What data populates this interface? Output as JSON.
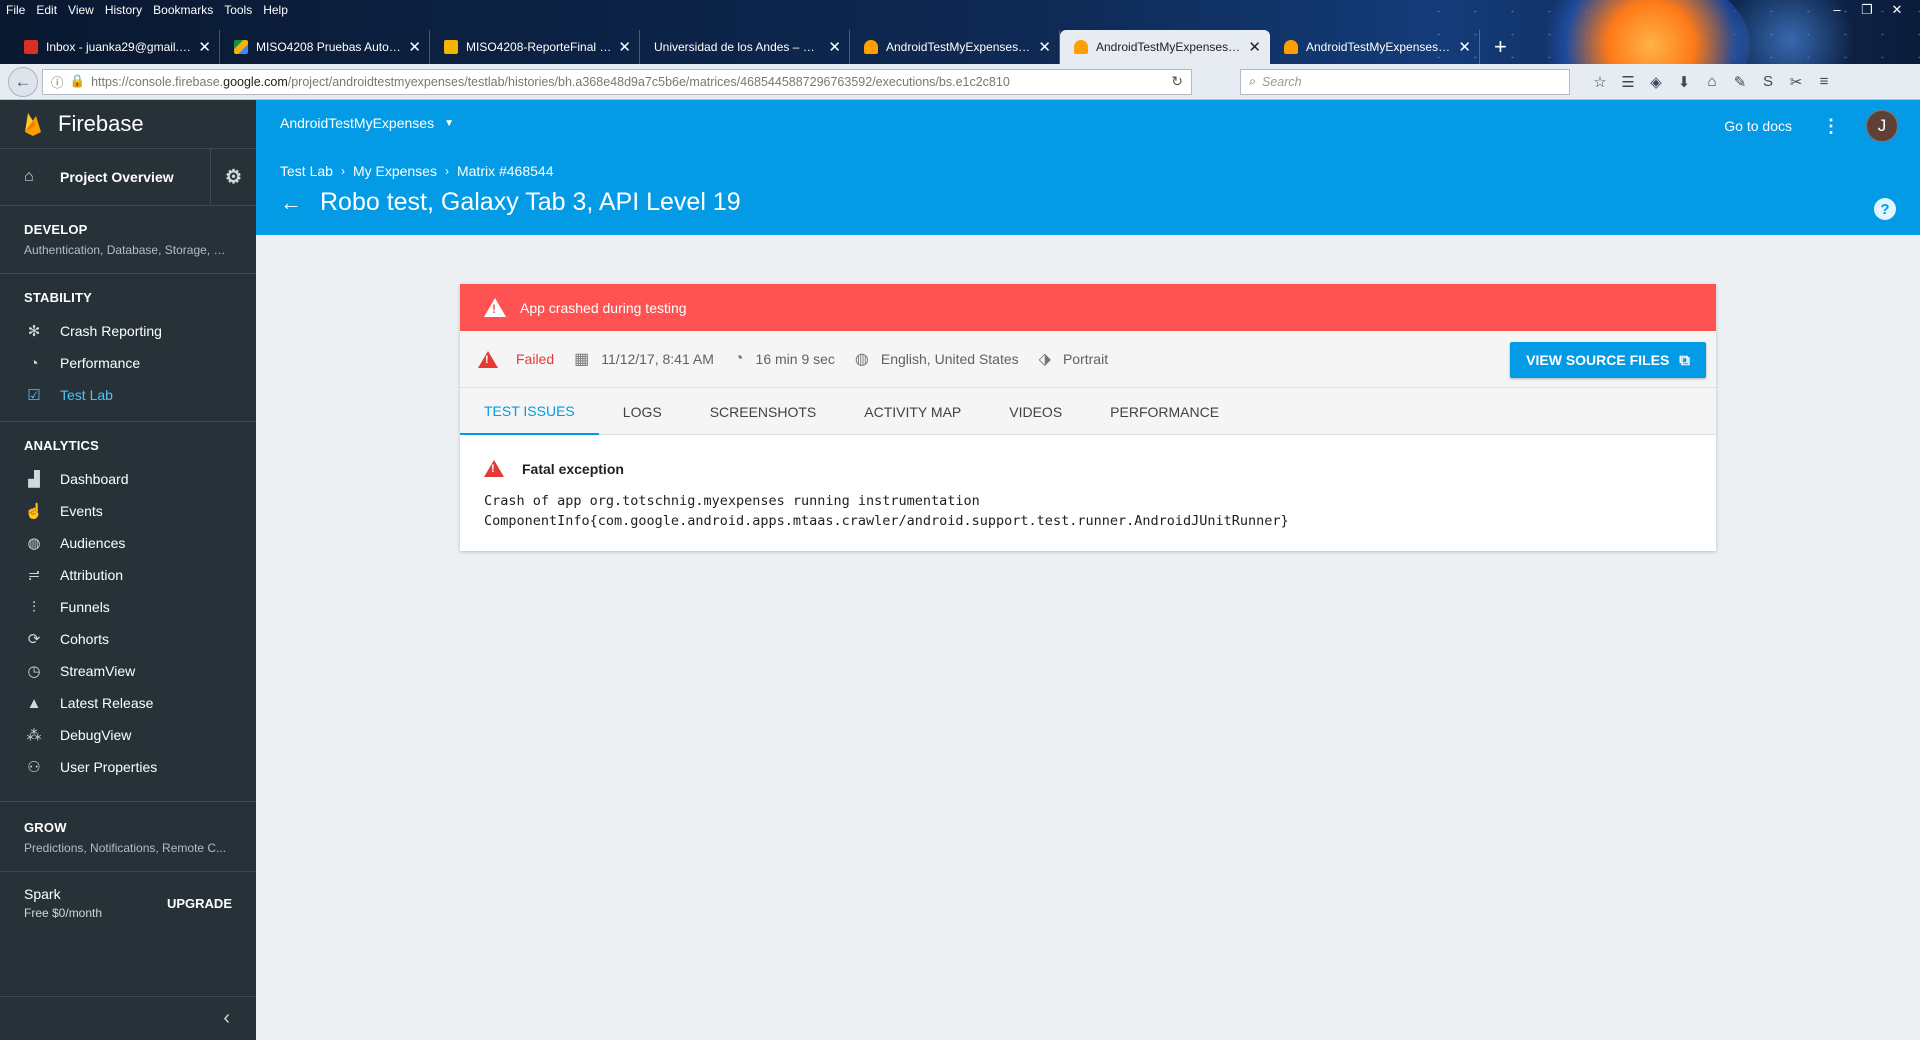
{
  "browser": {
    "menu": [
      "File",
      "Edit",
      "View",
      "History",
      "Bookmarks",
      "Tools",
      "Help"
    ],
    "tabs": [
      {
        "title": "Inbox - juanka29@gmail.com",
        "favicon_color": "#d93025",
        "active": false
      },
      {
        "title": "MISO4208 Pruebas Automat",
        "favicon_color": "#1e8e3e",
        "active": false
      },
      {
        "title": "MISO4208-ReporteFinal - Go",
        "favicon_color": "#f4b400",
        "active": false
      },
      {
        "title": "Universidad de los Andes – Colo",
        "favicon_color": "",
        "active": false
      },
      {
        "title": "AndroidTestMyExpenses – Te",
        "favicon_color": "#ffa000",
        "active": false
      },
      {
        "title": "AndroidTestMyExpenses – Te",
        "favicon_color": "#ffa000",
        "active": true
      },
      {
        "title": "AndroidTestMyExpenses – Te",
        "favicon_color": "#ffa000",
        "active": false
      }
    ],
    "url_prefix": "https://console.firebase.",
    "url_domain": "google.com",
    "url_path": "/project/androidtestmyexpenses/testlab/histories/bh.a368e48d9a7c5b6e/matrices/4685445887296763592/executions/bs.e1c2c810",
    "search_placeholder": "Search"
  },
  "sidebar": {
    "brand": "Firebase",
    "project_overview": "Project Overview",
    "develop": {
      "title": "DEVELOP",
      "sub": "Authentication, Database, Storage, H..."
    },
    "stability": {
      "title": "STABILITY",
      "items": [
        {
          "label": "Crash Reporting",
          "icon": "bug-icon"
        },
        {
          "label": "Performance",
          "icon": "speedometer-icon"
        },
        {
          "label": "Test Lab",
          "icon": "checklist-icon"
        }
      ]
    },
    "analytics": {
      "title": "ANALYTICS",
      "items": [
        {
          "label": "Dashboard",
          "icon": "bar-chart-icon"
        },
        {
          "label": "Events",
          "icon": "touch-icon"
        },
        {
          "label": "Audiences",
          "icon": "globe-icon"
        },
        {
          "label": "Attribution",
          "icon": "attribution-icon"
        },
        {
          "label": "Funnels",
          "icon": "funnel-icon"
        },
        {
          "label": "Cohorts",
          "icon": "cohorts-icon"
        },
        {
          "label": "StreamView",
          "icon": "clock-icon"
        },
        {
          "label": "Latest Release",
          "icon": "release-icon"
        },
        {
          "label": "DebugView",
          "icon": "debug-icon"
        },
        {
          "label": "User Properties",
          "icon": "users-icon"
        }
      ]
    },
    "grow": {
      "title": "GROW",
      "sub": "Predictions, Notifications, Remote C..."
    },
    "plan": {
      "name": "Spark",
      "price": "Free $0/month",
      "upgrade": "UPGRADE"
    }
  },
  "header": {
    "project": "AndroidTestMyExpenses",
    "go_to_docs": "Go to docs",
    "avatar_letter": "J",
    "breadcrumb": [
      "Test Lab",
      "My Expenses",
      "Matrix #468544"
    ],
    "title": "Robo test, Galaxy Tab 3, API Level 19"
  },
  "execution": {
    "alert": "App crashed during testing",
    "status": "Failed",
    "date": "11/12/17, 8:41 AM",
    "duration": "16 min 9 sec",
    "locale": "English, United States",
    "orientation": "Portrait",
    "view_source": "VIEW SOURCE FILES",
    "tabs": [
      "TEST ISSUES",
      "LOGS",
      "SCREENSHOTS",
      "ACTIVITY MAP",
      "VIDEOS",
      "PERFORMANCE"
    ],
    "issue_title": "Fatal exception",
    "issue_line1": "Crash of app org.totschnig.myexpenses running instrumentation",
    "issue_line2": "ComponentInfo{com.google.android.apps.mtaas.crawler/android.support.test.runner.AndroidJUnitRunner}"
  },
  "colors": {
    "sidebar_bg": "#263238",
    "header_blue": "#039be5",
    "alert_red": "#ff5252",
    "active_link": "#4fc3f7"
  }
}
